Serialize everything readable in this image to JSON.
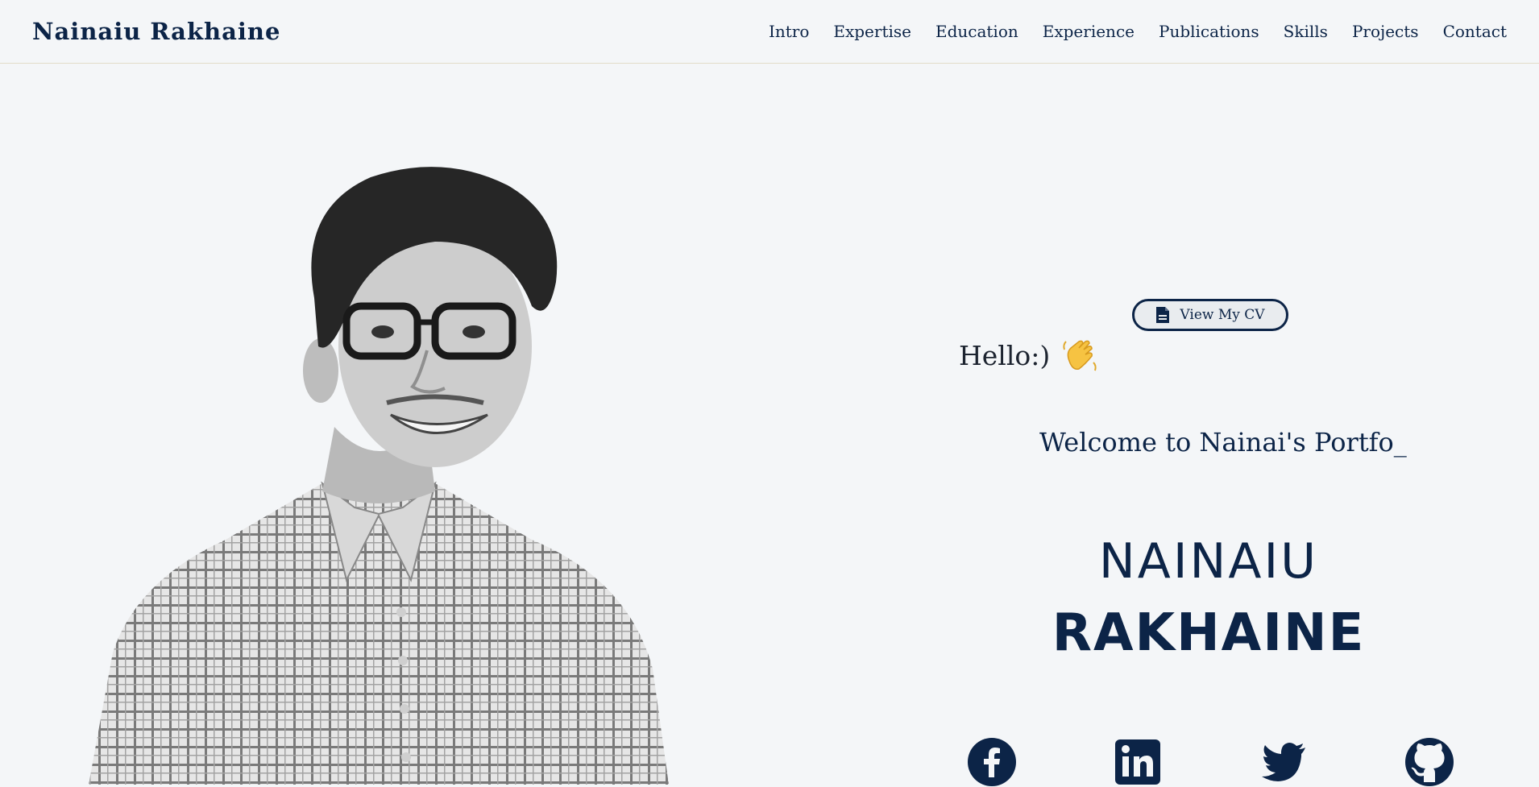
{
  "brand": "Nainaiu Rakhaine",
  "nav": {
    "items": [
      "Intro",
      "Expertise",
      "Education",
      "Experience",
      "Publications",
      "Skills",
      "Projects",
      "Contact"
    ]
  },
  "hero": {
    "cv_button_label": "View My CV",
    "greeting": "Hello:)",
    "welcome": "Welcome to Nainai's Portfo_",
    "first_name": "NAINAIU",
    "last_name": "RAKHAINE"
  },
  "socials": [
    "facebook-icon",
    "linkedin-icon",
    "twitter-icon",
    "github-icon"
  ],
  "colors": {
    "primary": "#0c2447",
    "background": "#f4f6f8",
    "navbar_border": "#e2dcc8"
  }
}
